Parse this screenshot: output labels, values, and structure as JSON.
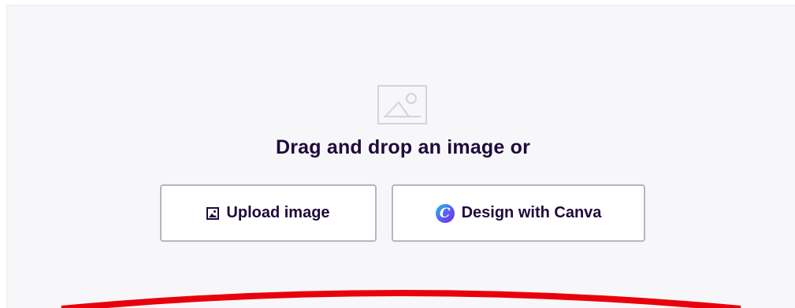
{
  "upload_area": {
    "prompt": "Drag and drop an image or",
    "placeholder_icon": "image-placeholder-icon"
  },
  "buttons": {
    "upload": {
      "label": "Upload image",
      "icon": "image-icon"
    },
    "canva": {
      "label": "Design with Canva",
      "icon": "canva-logo-icon"
    }
  },
  "colors": {
    "text": "#1e0a3c",
    "button_border": "#b7b5c1",
    "dropzone_bg": "#f7f7f9",
    "annotation_arc": "#e8000b"
  }
}
